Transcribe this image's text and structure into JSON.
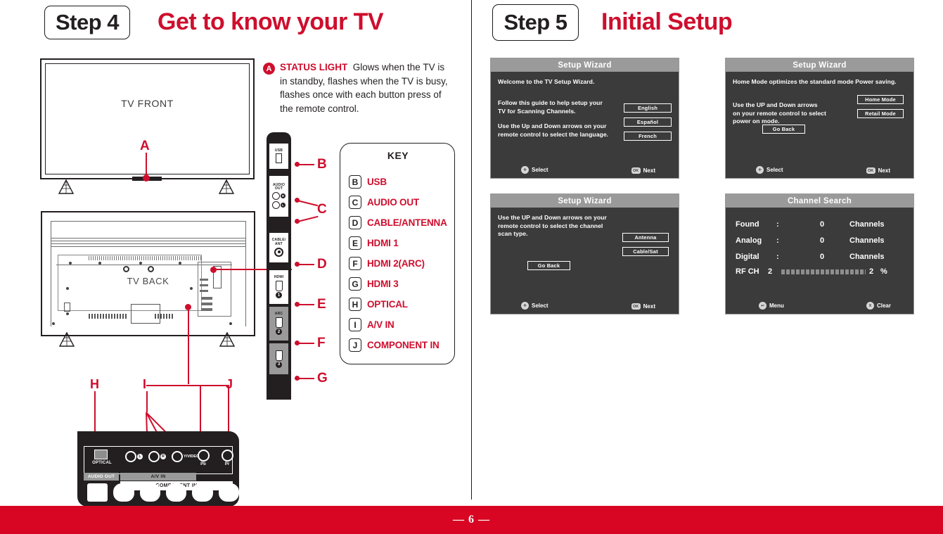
{
  "page": {
    "number": "— 6 —",
    "accent_red": "#CE0E2D",
    "footer_red": "#D80622"
  },
  "left_column": {
    "step_badge": "Step 4",
    "step_title": "Get to know your TV",
    "diagrams": {
      "front_label": "TV FRONT",
      "back_label": "TV BACK",
      "front_callout": "A"
    },
    "status_note": {
      "badge": "A",
      "term": "STATUS LIGHT",
      "body": "Glows when the TV is in standby, flashes when the TV is busy, flashes once with each button press of the remote control."
    },
    "side_panel_jacks": [
      {
        "caption": "USB",
        "type": "usb"
      },
      {
        "caption": "AUDIO OUT",
        "type": "rca-pair",
        "right": "R",
        "left": "L"
      },
      {
        "caption": "CABLE/ANT",
        "type": "coax"
      },
      {
        "caption": "HDMI",
        "type": "hdmi",
        "number": "1"
      },
      {
        "caption": "ARC",
        "type": "hdmi",
        "number": "2"
      },
      {
        "caption": "",
        "type": "hdmi",
        "number": "3"
      }
    ],
    "side_callouts": [
      "B",
      "C",
      "D",
      "E",
      "F",
      "G"
    ],
    "bottom_callouts": [
      "H",
      "I",
      "J"
    ],
    "bottom_panel": {
      "optical_label": "OPTICAL",
      "audio_out_label": "AUDIO OUT",
      "av_in_label": "A/V IN",
      "component_in_label": "COMPONENT IN",
      "av_jacks": [
        {
          "mini": "L",
          "text": ""
        },
        {
          "mini": "R",
          "text": ""
        },
        {
          "mini": "",
          "text": "Y/VIDEO"
        }
      ],
      "component_jacks": [
        {
          "label": "Pb"
        },
        {
          "label": "Pr"
        }
      ]
    },
    "key_box": {
      "title": "KEY",
      "items": [
        {
          "tag": "B",
          "name": "USB"
        },
        {
          "tag": "C",
          "name": "AUDIO OUT"
        },
        {
          "tag": "D",
          "name": "CABLE/ANTENNA"
        },
        {
          "tag": "E",
          "name": "HDMI 1"
        },
        {
          "tag": "F",
          "name": "HDMI 2(ARC)"
        },
        {
          "tag": "G",
          "name": "HDMI 3"
        },
        {
          "tag": "H",
          "name": "OPTICAL"
        },
        {
          "tag": "I",
          "name": "A/V IN"
        },
        {
          "tag": "J",
          "name": "COMPONENT IN"
        }
      ]
    }
  },
  "right_column": {
    "step_badge": "Step 5",
    "step_title": "Initial Setup",
    "screens": {
      "welcome": {
        "title": "Setup Wizard",
        "line1": "Welcome to the TV Setup Wizard.",
        "line2": "Follow this guide to help setup your\nTV for Scanning Channels.",
        "line3": "Use the Up and Down arrows on your\nremote control to select the language.",
        "options": [
          "English",
          "Español",
          "French"
        ],
        "footer_left": "Select",
        "footer_right": "Next",
        "icon_left": "OK",
        "icon_right": "OK"
      },
      "home_mode": {
        "title": "Setup Wizard",
        "line1": "Home Mode optimizes the standard mode Power saving.",
        "line2": "Use the UP and Down arrows\non your remote control  to select\npower on mode.",
        "options": [
          "Home Mode",
          "Retail Mode"
        ],
        "back_button": "Go Back",
        "footer_left": "Select",
        "footer_right": "Next"
      },
      "scan_type": {
        "title": "Setup Wizard",
        "line1": "Use the UP and Down arrows on your\nremote control  to select the channel\nscan type.",
        "options": [
          "Antenna",
          "Cable/Sat"
        ],
        "back_button": "Go Back",
        "footer_left": "Select",
        "footer_right": "Next"
      },
      "channel_search": {
        "title": "Channel Search",
        "rows": [
          {
            "label": "Found",
            "colon": ":",
            "value": "0",
            "unit": "Channels"
          },
          {
            "label": "Analog",
            "colon": ":",
            "value": "0",
            "unit": "Channels"
          },
          {
            "label": "Digital",
            "colon": ":",
            "value": "0",
            "unit": "Channels"
          }
        ],
        "rf_label": "RF CH",
        "rf_channel": "2",
        "rf_percent_value": "2",
        "rf_percent_sign": "%",
        "footer_left": "Menu",
        "footer_right": "Clear"
      }
    }
  }
}
